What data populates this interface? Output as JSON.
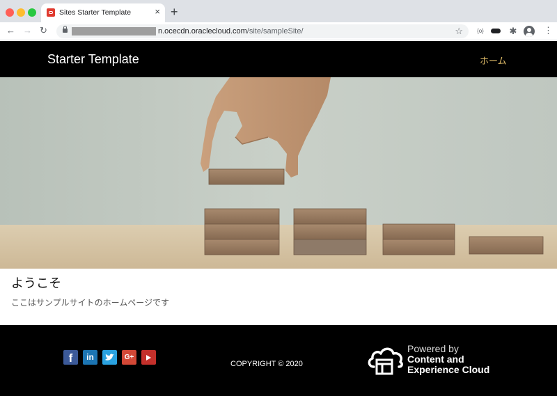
{
  "browser": {
    "tab": {
      "title": "Sites Starter Template",
      "close": "×"
    },
    "new_tab": "+",
    "url": {
      "host": "n.ocecdn.oraclecloud.com",
      "path": "/site/sampleSite/"
    },
    "extensions": {
      "a": "{o}",
      "puzzle": "✱"
    }
  },
  "site": {
    "title": "Starter Template",
    "nav": {
      "home": "ホーム"
    },
    "hero": {
      "image": "hand placing wooden blocks"
    },
    "content": {
      "heading": "ようこそ",
      "body": "ここはサンプルサイトのホームページです"
    },
    "footer": {
      "social": {
        "facebook": "f",
        "linkedin": "in",
        "twitter": "t",
        "googleplus": "G+"
      },
      "copyright": "COPYRIGHT © 2020",
      "powered": {
        "line1": "Powered by",
        "line2": "Content and",
        "line3": "Experience Cloud"
      }
    }
  },
  "colors": {
    "header_bg": "#000000",
    "nav_accent": "#e3be69",
    "footer_bg": "#000000"
  }
}
